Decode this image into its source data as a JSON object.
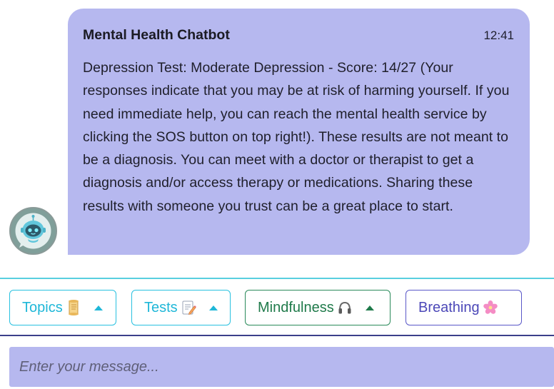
{
  "chat": {
    "bot_avatar": {
      "icon": "robot-avatar-icon"
    },
    "message": {
      "sender": "Mental Health Chatbot",
      "time": "12:41",
      "text": "Depression Test: Moderate Depression - Score: 14/27 (Your responses indicate that you may be at risk of harming yourself. If you need immediate help, you can reach the mental health service by clicking the SOS button on top right!). These results are not meant to be a diagnosis. You can meet with a doctor or therapist to get a diagnosis and/or access therapy or medications. Sharing these results with someone you trust can be a great place to start."
    }
  },
  "quick_replies": [
    {
      "label": "Topics",
      "icon": "scroll-icon",
      "has_dropdown": true,
      "color": "#1fb7d8"
    },
    {
      "label": "Tests",
      "icon": "memo-pencil-icon",
      "has_dropdown": true,
      "color": "#1fb7d8"
    },
    {
      "label": "Mindfulness",
      "icon": "headphones-icon",
      "has_dropdown": true,
      "color": "#1f7a4a"
    },
    {
      "label": "Breathing",
      "icon": "cherry-blossom-icon",
      "has_dropdown": false,
      "color": "#4c48b8"
    }
  ],
  "composer": {
    "placeholder": "Enter your message...",
    "value": ""
  },
  "colors": {
    "bubble_bg": "#b6b8ef",
    "input_bg": "#b6b8ef",
    "accent_cyan": "#29c1e0",
    "accent_green": "#2a8a5a",
    "accent_purple": "#5a58c8"
  }
}
